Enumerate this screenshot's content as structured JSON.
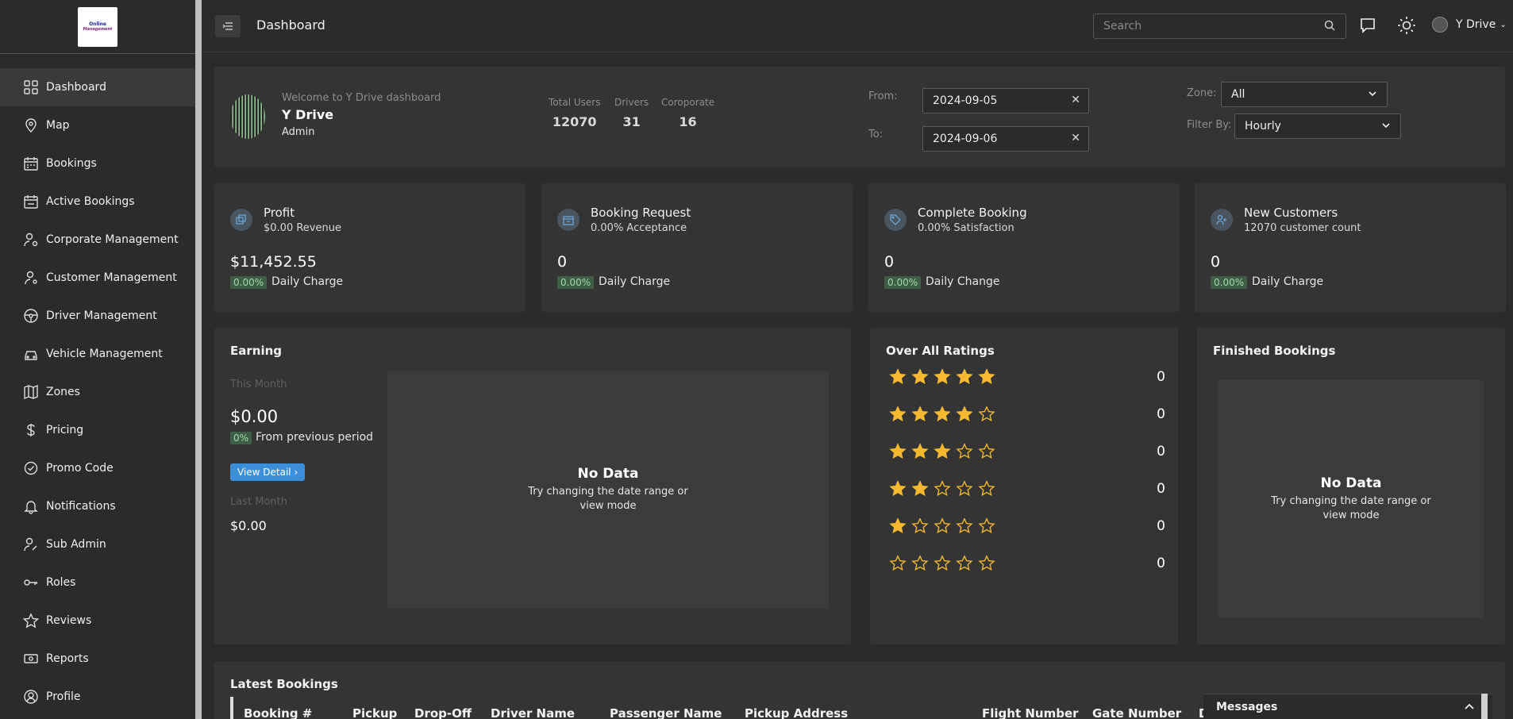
{
  "logo": {
    "line1": "Online",
    "line2": "Management"
  },
  "sidebar": {
    "items": [
      {
        "label": "Dashboard",
        "icon": "dashboard-icon"
      },
      {
        "label": "Map",
        "icon": "map-pin-icon"
      },
      {
        "label": "Bookings",
        "icon": "calendar-icon"
      },
      {
        "label": "Active Bookings",
        "icon": "calendar-check-icon"
      },
      {
        "label": "Corporate Management",
        "icon": "user-gear-icon"
      },
      {
        "label": "Customer Management",
        "icon": "user-settings-icon"
      },
      {
        "label": "Driver Management",
        "icon": "steering-wheel-icon"
      },
      {
        "label": "Vehicle Management",
        "icon": "car-icon"
      },
      {
        "label": "Zones",
        "icon": "map-icon"
      },
      {
        "label": "Pricing",
        "icon": "dollar-icon"
      },
      {
        "label": "Promo Code",
        "icon": "badge-check-icon"
      },
      {
        "label": "Notifications",
        "icon": "bell-icon"
      },
      {
        "label": "Sub Admin",
        "icon": "user-edit-icon"
      },
      {
        "label": "Roles",
        "icon": "key-icon"
      },
      {
        "label": "Reviews",
        "icon": "star-icon"
      },
      {
        "label": "Reports",
        "icon": "money-icon"
      },
      {
        "label": "Profile",
        "icon": "user-circle-icon"
      }
    ]
  },
  "header": {
    "title": "Dashboard",
    "search_placeholder": "Search",
    "user_name": "Y Drive"
  },
  "welcome": {
    "subtitle": "Welcome to Y Drive dashboard",
    "name": "Y Drive",
    "role": "Admin",
    "stats": [
      {
        "label": "Total Users",
        "value": "12070"
      },
      {
        "label": "Drivers",
        "value": "31"
      },
      {
        "label": "Coroporate",
        "value": "16"
      }
    ],
    "from_label": "From:",
    "from_value": "2024-09-05",
    "to_label": "To:",
    "to_value": "2024-09-06",
    "zone_label": "Zone:",
    "zone_value": "All",
    "filter_label": "Filter By:",
    "filter_value": "Hourly"
  },
  "stat_cards": [
    {
      "title": "Profit",
      "sub": "$0.00 Revenue",
      "value": "$11,452.55",
      "badge": "0.00%",
      "note": "Daily Charge",
      "icon": "copy-icon"
    },
    {
      "title": "Booking Request",
      "sub": "0.00% Acceptance",
      "value": "0",
      "badge": "0.00%",
      "note": "Daily Charge",
      "icon": "box-icon"
    },
    {
      "title": "Complete Booking",
      "sub": "0.00% Satisfaction",
      "value": "0",
      "badge": "0.00%",
      "note": "Daily Change",
      "icon": "tag-icon"
    },
    {
      "title": "New Customers",
      "sub": "12070 customer count",
      "value": "0",
      "badge": "0.00%",
      "note": "Daily Charge",
      "icon": "user-plus-icon"
    }
  ],
  "earning": {
    "title": "Earning",
    "this_month_label": "This Month",
    "this_month_value": "$0.00",
    "badge": "0%",
    "badge_note": "From previous period",
    "button": "View Detail",
    "last_month_label": "Last Month",
    "last_month_value": "$0.00",
    "nodata_title": "No Data",
    "nodata_text": "Try changing the date range or view mode"
  },
  "ratings": {
    "title": "Over All Ratings",
    "rows": [
      {
        "stars": 5,
        "count": "0"
      },
      {
        "stars": 4,
        "count": "0"
      },
      {
        "stars": 3,
        "count": "0"
      },
      {
        "stars": 2,
        "count": "0"
      },
      {
        "stars": 1,
        "count": "0"
      },
      {
        "stars": 0,
        "count": "0"
      }
    ]
  },
  "finished": {
    "title": "Finished Bookings",
    "nodata_title": "No Data",
    "nodata_text": "Try changing the date range or view mode"
  },
  "latest": {
    "title": "Latest Bookings",
    "columns": [
      "Booking #",
      "Pickup",
      "Drop-Off",
      "Driver Name",
      "Passenger Name",
      "Pickup Address",
      "Flight Number",
      "Gate Number",
      "D"
    ]
  },
  "messages": {
    "label": "Messages"
  },
  "colors": {
    "star": "#f5b82e",
    "accent": "#3b8fd9",
    "badge_bg": "#3f5e47",
    "badge_fg": "#9ed8a8"
  }
}
